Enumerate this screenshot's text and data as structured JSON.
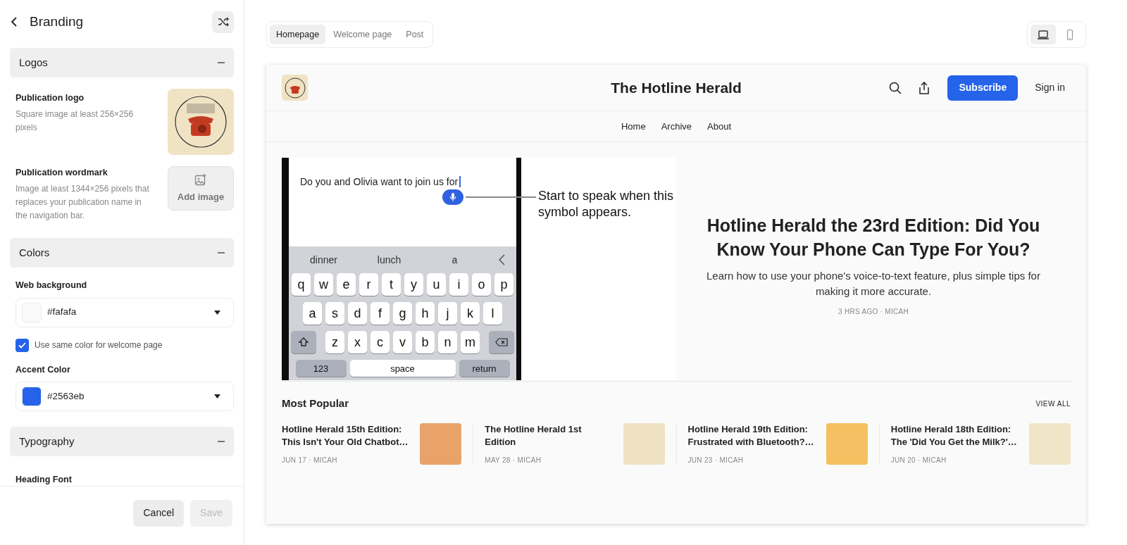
{
  "sidebar": {
    "title": "Branding",
    "logos": {
      "title": "Logos",
      "expanded": true,
      "publication_logo": {
        "label": "Publication logo",
        "hint": "Square image at least 256×256 pixels"
      },
      "wordmark": {
        "label": "Publication wordmark",
        "hint": "Image at least 1344×256 pixels that replaces your publication name in the navigation bar.",
        "button": "Add image"
      }
    },
    "colors": {
      "title": "Colors",
      "expanded": true,
      "web_background": {
        "label": "Web background",
        "value": "#fafafa",
        "color": "#fafafa"
      },
      "same_color": {
        "label": "Use same color for welcome page",
        "checked": true
      },
      "accent": {
        "label": "Accent Color",
        "value": "#2563eb",
        "color": "#2563eb"
      }
    },
    "typography": {
      "title": "Typography",
      "expanded": true,
      "heading_font": {
        "label": "Heading Font"
      }
    },
    "cancel": {
      "label": "Cancel"
    },
    "save": {
      "label": "Save",
      "disabled": true
    }
  },
  "preview": {
    "tabs": [
      {
        "label": "Homepage",
        "selected": true
      },
      {
        "label": "Welcome page",
        "selected": false
      },
      {
        "label": "Post",
        "selected": false
      }
    ],
    "devices": [
      {
        "kind": "laptop",
        "selected": true
      },
      {
        "kind": "phone",
        "selected": false
      }
    ],
    "site": {
      "title": "The Hotline Herald",
      "subscribe": "Subscribe",
      "sign_in": "Sign in",
      "nav": [
        "Home",
        "Archive",
        "About"
      ],
      "hero": {
        "image": {
          "message": "Do you and Olivia want to join us for",
          "suggestions": [
            "dinner",
            "lunch",
            "a"
          ],
          "keys": [
            [
              "q",
              "w",
              "e",
              "r",
              "t",
              "y",
              "u",
              "i",
              "o",
              "p"
            ],
            [
              "a",
              "s",
              "d",
              "f",
              "g",
              "h",
              "j",
              "k",
              "l"
            ],
            [
              "z",
              "x",
              "c",
              "v",
              "b",
              "n",
              "m"
            ]
          ],
          "bottom_keys": [
            "123",
            "space",
            "return"
          ],
          "callout": "Start to speak when this symbol appears."
        },
        "headline": "Hotline Herald the 23rd Edition: Did You Know Your Phone Can Type For You?",
        "summary": "Learn how to use your phone's voice-to-text feature, plus simple tips for making it more accurate.",
        "meta": "3 HRS AGO · MICAH"
      },
      "popular": {
        "title": "Most Popular",
        "view_all": "VIEW ALL",
        "posts": [
          {
            "title": "Hotline Herald 15th Edition: This Isn't Your Old Chatbot…",
            "meta": "JUN 17 · MICAH"
          },
          {
            "title": "The Hotline Herald 1st Edition",
            "meta": "MAY 28 · MICAH"
          },
          {
            "title": "Hotline Herald 19th Edition: Frustrated with Bluetooth?…",
            "meta": "JUN 23 · MICAH"
          },
          {
            "title": "Hotline Herald 18th Edition: The 'Did You Get the Milk?'…",
            "meta": "JUN 20 · MICAH"
          }
        ]
      }
    }
  }
}
